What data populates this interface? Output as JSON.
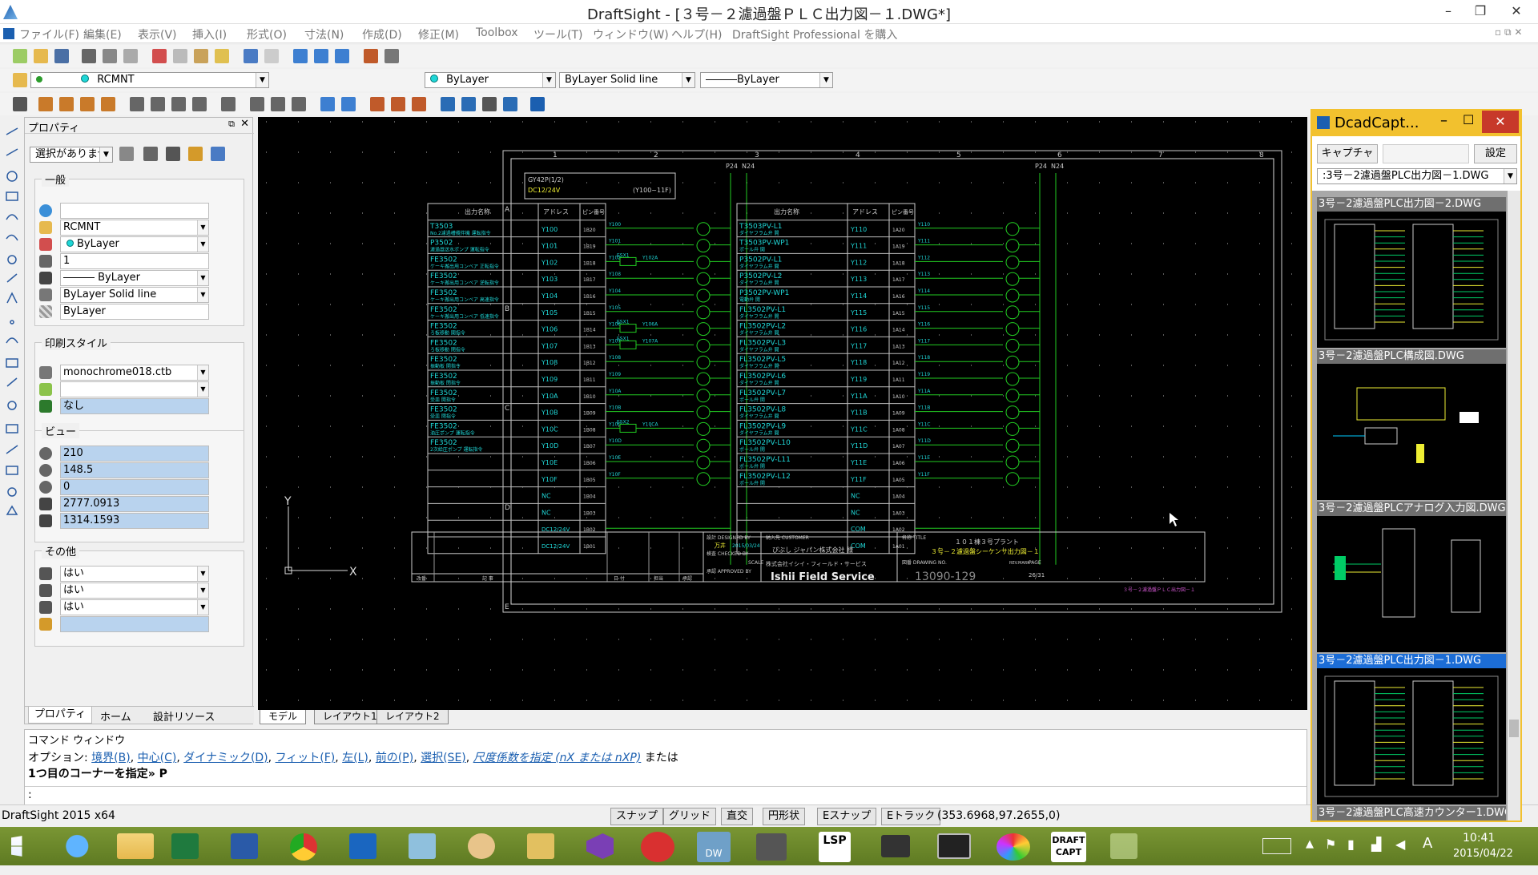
{
  "window": {
    "title": "DraftSight - [３号－２濾過盤ＰＬＣ出力図－１.DWG*]"
  },
  "menu": [
    "ファイル(F)",
    "編集(E)",
    "表示(V)",
    "挿入(I)",
    "形式(O)",
    "寸法(N)",
    "作成(D)",
    "修正(M)",
    "Toolbox",
    "ツール(T)",
    "ウィンドウ(W)",
    "ヘルプ(H)",
    "DraftSight Professional を購入"
  ],
  "layer": {
    "current": "RCMNT"
  },
  "props_bar": {
    "color": "ByLayer",
    "linestyle": "ByLayer     Solid line",
    "lineweight": "―――ByLayer"
  },
  "panel": {
    "title": "プロパティ",
    "selection": "選択がありません",
    "general": {
      "label": "一般",
      "values": [
        "",
        "RCMNT",
        "ByLayer",
        "1",
        "――― ByLayer",
        "ByLayer     Solid line",
        "ByLayer"
      ]
    },
    "print": {
      "label": "印刷スタイル",
      "values": [
        "monochrome018.ctb",
        "",
        "なし"
      ]
    },
    "view": {
      "label": "ビュー",
      "values": [
        "210",
        "148.5",
        "0",
        "2777.0913",
        "1314.1593"
      ]
    },
    "other": {
      "label": "その他",
      "values": [
        "はい",
        "はい",
        "はい",
        ""
      ]
    },
    "tabs": [
      "プロパティ",
      "ホーム",
      "設計リソース"
    ]
  },
  "sheet_tabs": [
    "モデル",
    "レイアウト1",
    "レイアウト2"
  ],
  "drawing": {
    "header1": "GY42P(1/2)",
    "header2": "DC12/24V",
    "header3": "(Y100~11F)",
    "col_name": "出力名称",
    "col_addr": "アドレス",
    "col_pin": "ピン番号",
    "p24": "P24",
    "n24": "N24",
    "left_rows": [
      {
        "n": "T3503",
        "d": "No.2濾過槽攪拌機 運転指令",
        "a": "Y100",
        "p": "1B20"
      },
      {
        "n": "P3502",
        "d": "濾過器送水ポンプ 運転指令",
        "a": "Y101",
        "p": "1B19"
      },
      {
        "n": "FE3502",
        "d": "ケーキ搬出用コンベア 正転指令",
        "a": "Y102",
        "p": "1B18"
      },
      {
        "n": "FE3502",
        "d": "ケーキ搬出用コンベア 逆転指令",
        "a": "Y103",
        "p": "1B17"
      },
      {
        "n": "FE3502",
        "d": "ケーキ搬出用コンベア 高速指令",
        "a": "Y104",
        "p": "1B16"
      },
      {
        "n": "FE3502",
        "d": "ケーキ搬出用コンベア 低速指令",
        "a": "Y105",
        "p": "1B15"
      },
      {
        "n": "FE3502",
        "d": "ろ板移動 開指令",
        "a": "Y106",
        "p": "1B14"
      },
      {
        "n": "FE3502",
        "d": "ろ板移動 閉指令",
        "a": "Y107",
        "p": "1B13"
      },
      {
        "n": "FE3502",
        "d": "振動板 開指令",
        "a": "Y108",
        "p": "1B12"
      },
      {
        "n": "FE3502",
        "d": "振動板 閉指令",
        "a": "Y109",
        "p": "1B11"
      },
      {
        "n": "FE3502",
        "d": "受皿 開指令",
        "a": "Y10A",
        "p": "1B10"
      },
      {
        "n": "FE3502",
        "d": "受皿 閉指令",
        "a": "Y10B",
        "p": "1B09"
      },
      {
        "n": "FE3502",
        "d": "油圧ポンプ 運転指令",
        "a": "Y10C",
        "p": "1B08"
      },
      {
        "n": "FE3502",
        "d": "2次給圧ポンプ 運転指令",
        "a": "Y10D",
        "p": "1B07"
      },
      {
        "n": "",
        "d": "",
        "a": "Y10E",
        "p": "1B06"
      },
      {
        "n": "",
        "d": "",
        "a": "Y10F",
        "p": "1B05"
      },
      {
        "n": "",
        "d": "",
        "a": "NC",
        "p": "1B04"
      },
      {
        "n": "",
        "d": "",
        "a": "NC",
        "p": "1B03"
      },
      {
        "n": "",
        "d": "",
        "a": "DC12/24V",
        "p": "1B02"
      },
      {
        "n": "",
        "d": "",
        "a": "DC12/24V",
        "p": "1B01"
      }
    ],
    "right_rows": [
      {
        "n": "T3503PV-L1",
        "d": "ダイヤフラム弁 開",
        "a": "Y110",
        "p": "1A20"
      },
      {
        "n": "T3503PV-WP1",
        "d": "ポール弁 開",
        "a": "Y111",
        "p": "1A19"
      },
      {
        "n": "P3502PV-L1",
        "d": "ダイヤフラム弁 開",
        "a": "Y112",
        "p": "1A18"
      },
      {
        "n": "P3502PV-L2",
        "d": "ダイヤフラム弁 開",
        "a": "Y113",
        "p": "1A17"
      },
      {
        "n": "P3502PV-WP1",
        "d": "電動弁 開",
        "a": "Y114",
        "p": "1A16"
      },
      {
        "n": "FL3502PV-L1",
        "d": "ダイヤフラム弁 開",
        "a": "Y115",
        "p": "1A15"
      },
      {
        "n": "FL3502PV-L2",
        "d": "ダイヤフラム弁 開",
        "a": "Y116",
        "p": "1A14"
      },
      {
        "n": "FL3502PV-L3",
        "d": "ダイヤフラム弁 開",
        "a": "Y117",
        "p": "1A13"
      },
      {
        "n": "FL3502PV-L5",
        "d": "ダイヤフラム弁 開",
        "a": "Y118",
        "p": "1A12"
      },
      {
        "n": "FL3502PV-L6",
        "d": "ダイヤフラム弁 開",
        "a": "Y119",
        "p": "1A11"
      },
      {
        "n": "FL3502PV-L7",
        "d": "ポール弁 開",
        "a": "Y11A",
        "p": "1A10"
      },
      {
        "n": "FL3502PV-L8",
        "d": "ダイヤフラム弁 開",
        "a": "Y11B",
        "p": "1A09"
      },
      {
        "n": "FL3502PV-L9",
        "d": "ダイヤフラム弁 開",
        "a": "Y11C",
        "p": "1A08"
      },
      {
        "n": "FL3502PV-L10",
        "d": "ポール弁 開",
        "a": "Y11D",
        "p": "1A07"
      },
      {
        "n": "FL3502PV-L11",
        "d": "ポール弁 開",
        "a": "Y11E",
        "p": "1A06"
      },
      {
        "n": "FL3502PV-L12",
        "d": "ポール弁 開",
        "a": "Y11F",
        "p": "1A05"
      },
      {
        "n": "",
        "d": "",
        "a": "NC",
        "p": "1A04"
      },
      {
        "n": "",
        "d": "",
        "a": "NC",
        "p": "1A03"
      },
      {
        "n": "",
        "d": "",
        "a": "COM",
        "p": "1A02"
      },
      {
        "n": "",
        "d": "",
        "a": "COM",
        "p": "1A01"
      }
    ],
    "relays": [
      {
        "row": 2,
        "label": "ESX1",
        "addr": "Y102A"
      },
      {
        "row": 6,
        "label": "ESX1",
        "addr": "Y106A"
      },
      {
        "row": 7,
        "label": "ESX1",
        "addr": "Y107A"
      },
      {
        "row": 12,
        "label": "ESX2",
        "addr": "Y10CA"
      }
    ],
    "grid_numbers": [
      "1",
      "2",
      "3",
      "4",
      "5",
      "6",
      "7",
      "8"
    ],
    "grid_letters": [
      "A",
      "B",
      "C",
      "D",
      "E"
    ],
    "tb_designed": "設計 DESIGNED BY",
    "tb_designer": "万井",
    "tb_date": "2015/03/24",
    "tb_checked": "検査 CHECKED BY",
    "tb_approved": "承認 APPROVED BY",
    "tb_customer_label": "納入先 CUSTOMER",
    "tb_customer": "びぶし ジャパン株式会社 様",
    "tb_title_label": "名称 TITLE",
    "tb_title1": "１０１棟３号プラント",
    "tb_title2": "３号－２濾過盤シーケンサ出力図－１",
    "tb_company": "株式会社イシイ・フィールド・サービス",
    "tb_logo": "Ishii Field Service",
    "tb_scale": "SCALE",
    "tb_drawing_no_label": "図番 DRAWING NO.",
    "tb_drawing_no": "13090-129",
    "tb_rev": "REV.MARK",
    "tb_page_label": "PAGE",
    "tb_page": "26/31",
    "tb_footer": "３号－２濾過盤ＰＬＣ出力図－１",
    "tb_revcol": [
      "改番",
      "記 事",
      "日 付",
      "担当",
      "承認"
    ]
  },
  "command": {
    "title": "コマンド ウィンドウ",
    "options_prefix": "オプション:",
    "options": [
      "境界(B)",
      "中心(C)",
      "ダイナミック(D)",
      "フィット(F)",
      "左(L)",
      "前の(P)",
      "選択(SE)"
    ],
    "options_italic": "尺度係数を指定 (nX または nXP)",
    "options_suffix": "または",
    "prompt": "1つ目のコーナーを指定» P",
    "input": ":"
  },
  "status": {
    "app": "DraftSight 2015 x64",
    "buttons": [
      "スナップ",
      "グリッド",
      "直交",
      "円形状",
      "Eスナップ",
      "Eトラック"
    ],
    "coords": "(353.6968,97.2655,0)"
  },
  "dcad": {
    "title": "DcadCapt...",
    "capture": "キャプチャ",
    "settings": "設定",
    "combo": ":3号－2濾過盤PLC出力図－1.DWG",
    "thumbs": [
      "3号－2濾過盤PLC出力図－2.DWG",
      "3号－2濾過盤PLC構成図.DWG",
      "3号－2濾過盤PLCアナログ入力図.DWG",
      "3号－2濾過盤PLC出力図－1.DWG",
      "3号－2濾過盤PLC高速カウンター1.DWG"
    ]
  },
  "taskbar": {
    "time": "10:41",
    "date": "2015/04/22",
    "ime": "A",
    "lsp": "LSP",
    "draft": "DRAFT",
    "capt": "CAPT"
  }
}
